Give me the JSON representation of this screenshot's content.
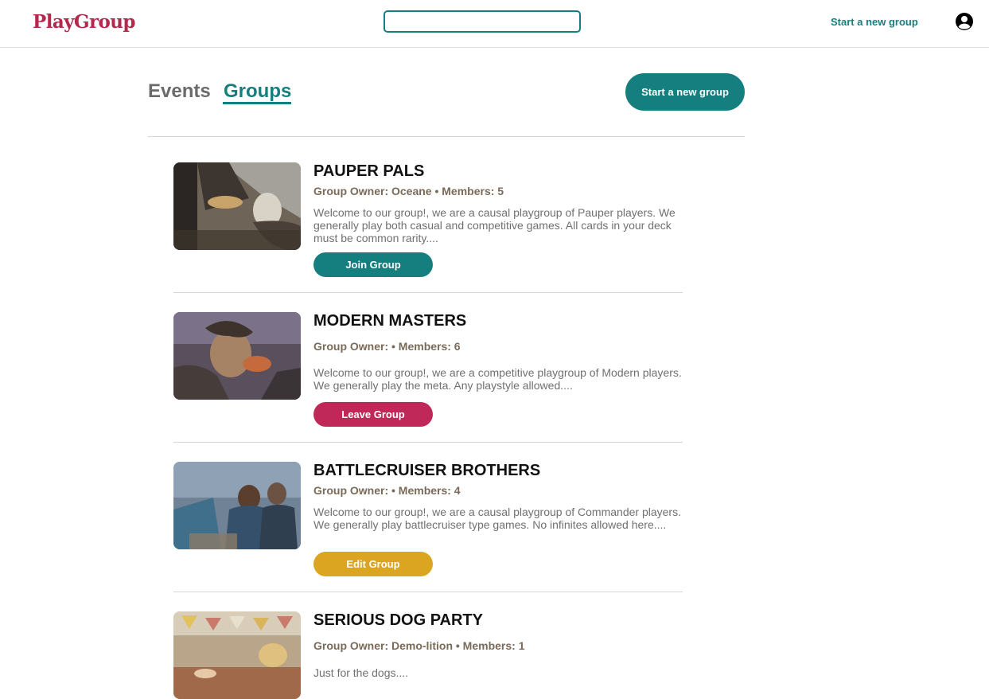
{
  "header": {
    "logo": "PlayGroup",
    "search_value": "",
    "start_link": "Start a new group",
    "profile_icon": "account-circle-icon"
  },
  "tabs": [
    {
      "label": "Events",
      "active": false
    },
    {
      "label": "Groups",
      "active": true
    }
  ],
  "start_button": "Start a new group",
  "colors": {
    "brand": "#b5274d",
    "primary": "#157f7f",
    "leave": "#c0285a",
    "edit": "#dba521"
  },
  "groups": [
    {
      "title": "PAUPER PALS",
      "meta": "Group Owner: Oceane • Members: 5",
      "description": "Welcome to our group!, we are a causal playgroup of Pauper players. We generally play both casual and competitive games. All cards in your deck must be common rarity....",
      "button": "Join Group",
      "button_color": "#157f7f"
    },
    {
      "title": "MODERN MASTERS",
      "meta": "Group Owner: • Members: 6",
      "description": "Welcome to our group!, we are a competitive playgroup of Modern players. We generally play the meta. Any playstyle allowed....",
      "button": "Leave Group",
      "button_color": "#c0285a"
    },
    {
      "title": "BATTLECRUISER BROTHERS",
      "meta": "Group Owner: • Members: 4",
      "description": "Welcome to our group!, we are a causal playgroup of Commander players. We generally play battlecruiser type games. No infinites allowed here....",
      "button": "Edit Group",
      "button_color": "#dba521"
    },
    {
      "title": "SERIOUS DOG PARTY",
      "meta": "Group Owner: Demo-lition • Members: 1",
      "description": "Just for the dogs....",
      "button": "",
      "button_color": ""
    }
  ]
}
